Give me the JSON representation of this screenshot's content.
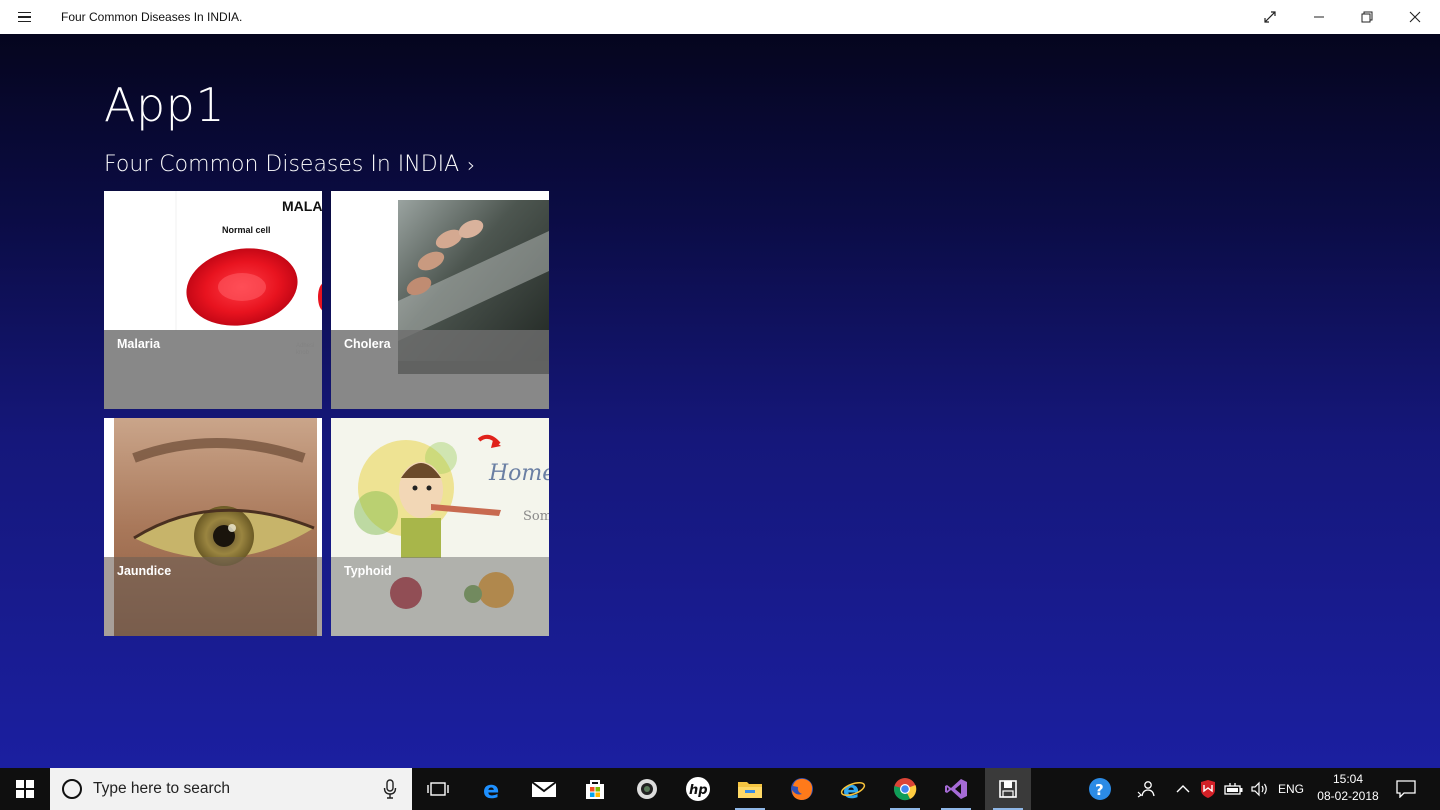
{
  "window": {
    "title": "Four Common Diseases In INDIA.",
    "controls": [
      "fullscreen-icon",
      "minimize-icon",
      "restore-icon",
      "close-icon"
    ]
  },
  "app": {
    "title": "App1",
    "section_header": "Four Common Diseases In INDIA",
    "section_chevron": "›"
  },
  "tiles": [
    {
      "label": "Malaria",
      "image_text": {
        "heading": "MALA",
        "caption": "Normal cell",
        "small": "Adhesi\nknob"
      }
    },
    {
      "label": "Cholera"
    },
    {
      "label": "Jaundice"
    },
    {
      "label": "Typhoid",
      "image_text": {
        "line1": "Home",
        "line2": "Som"
      }
    }
  ],
  "taskbar": {
    "search_placeholder": "Type here to search",
    "language": "ENG",
    "time": "15:04",
    "date": "08-02-2018",
    "icons": [
      "start-icon",
      "cortana-icon",
      "microphone-icon",
      "task-view-icon",
      "edge-icon",
      "mail-icon",
      "store-icon",
      "camera-app-icon",
      "hp-icon",
      "file-explorer-icon",
      "firefox-icon",
      "internet-explorer-icon",
      "chrome-icon",
      "visual-studio-icon",
      "app1-icon",
      "help-icon",
      "people-icon",
      "show-hidden-icons-icon",
      "mcafee-icon",
      "battery-icon",
      "volume-icon",
      "notifications-icon"
    ]
  },
  "colors": {
    "bg_top": "#05051e",
    "bg_bottom": "#1b1fa0",
    "tile_overlay": "#6e6e6e",
    "taskbar": "#0f0f0f"
  }
}
